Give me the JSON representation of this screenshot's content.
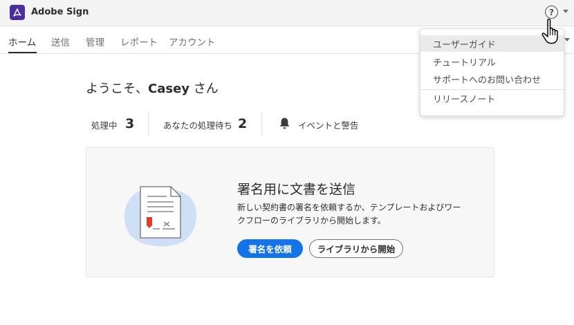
{
  "app": {
    "title": "Adobe Sign",
    "logo_icon": "adobe-acrobat-sign-icon",
    "brand_color": "#4b2d9f"
  },
  "help": {
    "icon": "help-circle-icon",
    "symbol": "?"
  },
  "nav": {
    "tabs": [
      {
        "label": "ホーム",
        "active": true
      },
      {
        "label": "送信",
        "active": false
      },
      {
        "label": "管理",
        "active": false
      },
      {
        "label": "レポート",
        "active": false
      },
      {
        "label": "アカウント",
        "active": false
      }
    ]
  },
  "greeting": {
    "prefix": "ようこそ、",
    "name": "Casey",
    "suffix": " さん"
  },
  "stats": {
    "in_progress_label": "処理中",
    "in_progress_count": "3",
    "waiting_label": "あなたの処理待ち",
    "waiting_count": "2",
    "events_label": "イベントと警告",
    "events_icon": "bell-icon"
  },
  "card": {
    "title": "署名用に文書を送信",
    "description": "新しい契約書の署名を依頼するか、テンプレートおよびワークフローのライブラリから開始します。",
    "primary_button": "署名を依頼",
    "secondary_button": "ライブラリから開始",
    "illustration_icon": "document-sign-illustration"
  },
  "help_menu": {
    "items": [
      {
        "label": "ユーザーガイド",
        "hover": true
      },
      {
        "label": "チュートリアル",
        "hover": false
      },
      {
        "label": "サポートへのお問い合わせ",
        "hover": false
      },
      {
        "label": "リリースノート",
        "hover": false
      }
    ]
  },
  "colors": {
    "accent_blue": "#1473e6",
    "text": "#2c2c2c",
    "signature_red": "#e03c2f"
  }
}
